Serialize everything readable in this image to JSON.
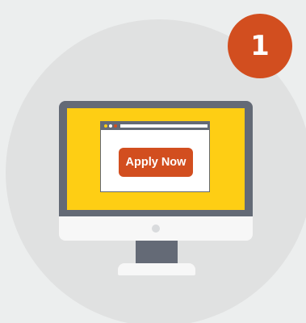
{
  "step": {
    "number": "1"
  },
  "browser": {
    "apply_button_label": "Apply Now"
  },
  "colors": {
    "background": "#eceeee",
    "circle": "#e0e1e1",
    "accent": "#d24e1f",
    "screen": "#fece14",
    "monitor": "#646a76",
    "bezel": "#f7f7f7"
  },
  "icons": {
    "computer": "desktop-monitor-icon",
    "browser": "browser-window-icon"
  }
}
